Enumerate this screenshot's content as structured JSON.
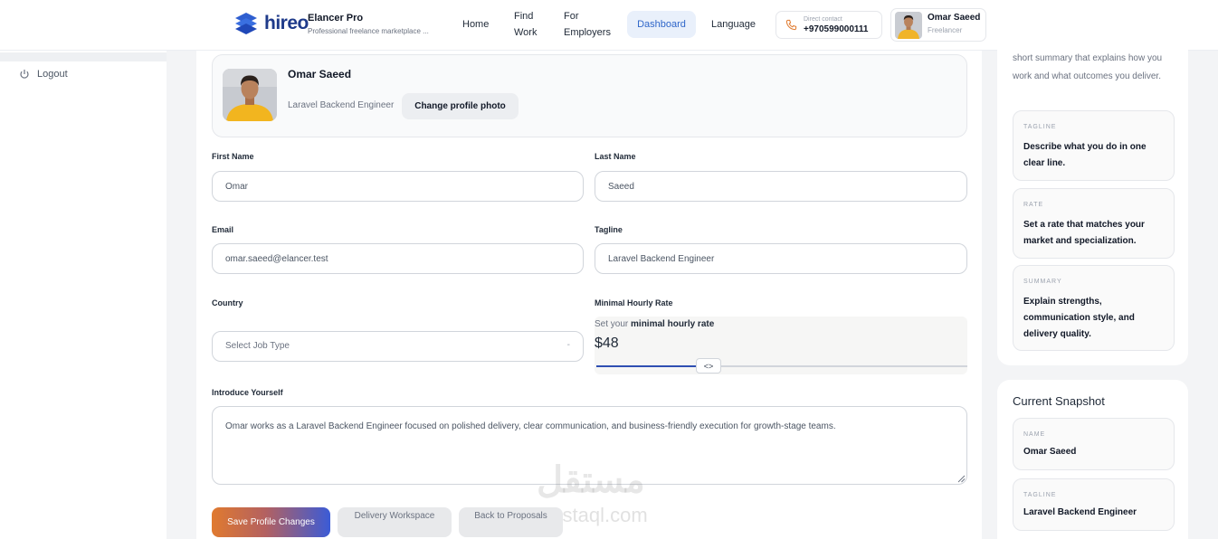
{
  "header": {
    "brand_word": "hireo",
    "app_title": "Elancer Pro",
    "app_subtitle": "Professional freelance marketplace ...",
    "nav": [
      {
        "label_line1": "Home",
        "label_line2": ""
      },
      {
        "label_line1": "Find",
        "label_line2": "Work"
      },
      {
        "label_line1": "For",
        "label_line2": "Employers"
      },
      {
        "label_line1": "Dashboard",
        "label_line2": "",
        "active": true
      },
      {
        "label_line1": "Language",
        "label_line2": ""
      }
    ],
    "contact": {
      "label": "Direct contact",
      "phone": "+970599000111",
      "icon": "phone-icon",
      "accent": "#e07a2f"
    },
    "user": {
      "name": "Omar Saeed",
      "role": "Freelancer"
    }
  },
  "sidebar": {
    "logout_label": "Logout",
    "logout_icon": "power-icon"
  },
  "profile": {
    "name": "Omar Saeed",
    "role": "Laravel Backend Engineer",
    "change_photo_label": "Change profile photo"
  },
  "form": {
    "first_name": {
      "label": "First Name",
      "value": "Omar"
    },
    "last_name": {
      "label": "Last Name",
      "value": "Saeed"
    },
    "email": {
      "label": "Email",
      "value": "omar.saeed@elancer.test"
    },
    "tagline": {
      "label": "Tagline",
      "value": "Laravel Backend Engineer"
    },
    "country": {
      "label": "Country",
      "selected": "Select Job Type",
      "caret": "-"
    },
    "rate": {
      "label": "Minimal Hourly Rate",
      "hint_prefix": "Set your",
      "hint_bold": "minimal hourly rate",
      "value_text": "$48",
      "slider_fraction": 0.27,
      "handle_glyph": "<>"
    },
    "intro": {
      "label": "Introduce Yourself",
      "value": "Omar works as a Laravel Backend Engineer focused on polished delivery, clear communication, and business-friendly execution for growth-stage teams."
    }
  },
  "actions": {
    "save_label": "Save Profile Changes",
    "delivery_label": "Delivery Workspace",
    "back_label": "Back to Proposals"
  },
  "watermark": {
    "arabic": "مستقل",
    "latin": "mostaql.com"
  },
  "right_panel": {
    "intro": "short summary that explains how you work and what outcomes you deliver.",
    "tips": [
      {
        "tag": "TAGLINE",
        "text": "Describe what you do in one clear line."
      },
      {
        "tag": "RATE",
        "text": "Set a rate that matches your market and specialization."
      },
      {
        "tag": "SUMMARY",
        "text": "Explain strengths, communication style, and delivery quality."
      }
    ],
    "snapshot_title": "Current Snapshot",
    "snapshot": [
      {
        "tag": "NAME",
        "value": "Omar Saeed"
      },
      {
        "tag": "TAGLINE",
        "value": "Laravel Backend Engineer"
      }
    ]
  },
  "colors": {
    "accent_blue": "#2f66c9",
    "slider_fill": "#2f4fb2",
    "save_gradient_start": "#e07a2f",
    "save_gradient_end": "#3b5bd6"
  }
}
